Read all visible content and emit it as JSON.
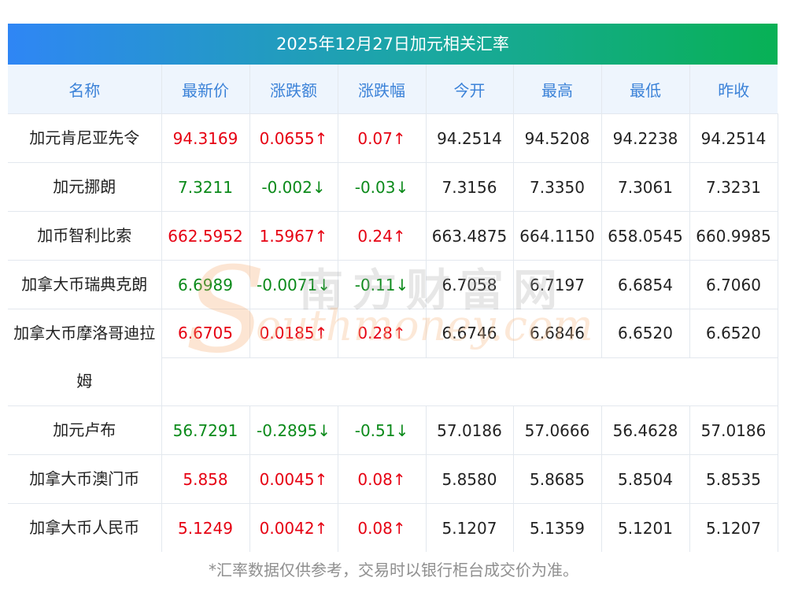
{
  "title": "2025年12月27日加元相关汇率",
  "headers": [
    "名称",
    "最新价",
    "涨跌额",
    "涨跌幅",
    "今开",
    "最高",
    "最低",
    "昨收"
  ],
  "rows": [
    {
      "name": "加元肯尼亚先令",
      "latest": "94.3169",
      "change": "0.0655↑",
      "pct": "0.07↑",
      "open": "94.2514",
      "high": "94.5208",
      "low": "94.2238",
      "prev": "94.2514",
      "dir": "up"
    },
    {
      "name": "加元挪朗",
      "latest": "7.3211",
      "change": "-0.002↓",
      "pct": "-0.03↓",
      "open": "7.3156",
      "high": "7.3350",
      "low": "7.3061",
      "prev": "7.3231",
      "dir": "down"
    },
    {
      "name": "加币智利比索",
      "latest": "662.5952",
      "change": "1.5967↑",
      "pct": "0.24↑",
      "open": "663.4875",
      "high": "664.1150",
      "low": "658.0545",
      "prev": "660.9985",
      "dir": "up"
    },
    {
      "name": "加拿大币瑞典克朗",
      "latest": "6.6989",
      "change": "-0.0071↓",
      "pct": "-0.11↓",
      "open": "6.7058",
      "high": "6.7197",
      "low": "6.6854",
      "prev": "6.7060",
      "dir": "down"
    },
    {
      "name": "加拿大币摩洛哥迪拉姆",
      "latest": "6.6705",
      "change": "0.0185↑",
      "pct": "0.28↑",
      "open": "6.6746",
      "high": "6.6846",
      "low": "6.6520",
      "prev": "6.6520",
      "dir": "up"
    },
    {
      "name": "加元卢布",
      "latest": "56.7291",
      "change": "-0.2895↓",
      "pct": "-0.51↓",
      "open": "57.0186",
      "high": "57.0666",
      "low": "56.4628",
      "prev": "57.0186",
      "dir": "down"
    },
    {
      "name": "加拿大币澳门币",
      "latest": "5.858",
      "change": "0.0045↑",
      "pct": "0.08↑",
      "open": "5.8580",
      "high": "5.8685",
      "low": "5.8504",
      "prev": "5.8535",
      "dir": "up"
    },
    {
      "name": "加拿大币人民币",
      "latest": "5.1249",
      "change": "0.0042↑",
      "pct": "0.08↑",
      "open": "5.1207",
      "high": "5.1359",
      "low": "5.1201",
      "prev": "5.1207",
      "dir": "up"
    }
  ],
  "footnote": "*汇率数据仅供参考，交易时以银行柜台成交价为准。",
  "watermark": {
    "cn": "南方财富网",
    "en": "outhmoney.com",
    "s": "S"
  },
  "colors": {
    "up": "#e60012",
    "down": "#0b8a1a",
    "header_text": "#3b82d8",
    "header_bg": "#eef5fd",
    "title_gradient_start": "#2f86f5",
    "title_gradient_end": "#08b155"
  }
}
